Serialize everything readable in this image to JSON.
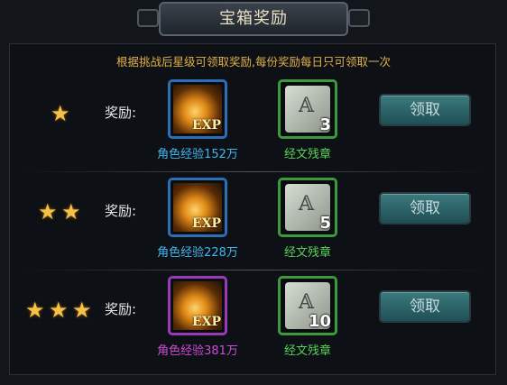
{
  "title": "宝箱奖励",
  "instruction": "根据挑战后星级可领取奖励,每份奖励每日只可领取一次",
  "reward_label": "奖励:",
  "rows": [
    {
      "stars": 1,
      "exp_icon_text": "EXP",
      "exp_caption": "角色经验152万",
      "item_name": "经文残章",
      "item_count": "3",
      "claim_label": "领取"
    },
    {
      "stars": 2,
      "exp_icon_text": "EXP",
      "exp_caption": "角色经验228万",
      "item_name": "经文残章",
      "item_count": "5",
      "claim_label": "领取"
    },
    {
      "stars": 3,
      "exp_icon_text": "EXP",
      "exp_caption": "角色经验381万",
      "item_name": "经文残章",
      "item_count": "10",
      "claim_label": "领取"
    }
  ],
  "colors": {
    "instruction": "#e3b04b",
    "exp_caption_normal": "#42b6ef",
    "exp_caption_purple": "#d04ad8",
    "item_caption": "#59d159",
    "star": "#f4c24a"
  }
}
